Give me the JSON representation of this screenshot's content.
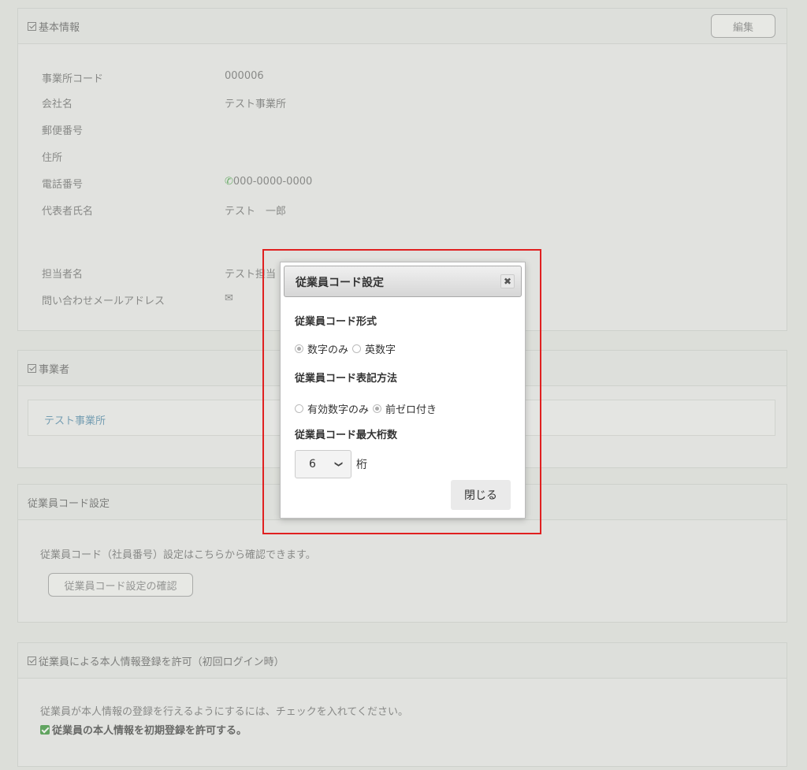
{
  "basic_info": {
    "title": "基本情報",
    "edit_label": "編集",
    "rows": [
      {
        "label": "事業所コード",
        "value": "000006"
      },
      {
        "label": "会社名",
        "value": "テスト事業所"
      },
      {
        "label": "郵便番号",
        "value": ""
      },
      {
        "label": "住所",
        "value": ""
      },
      {
        "label": "電話番号",
        "value": "000-0000-0000"
      },
      {
        "label": "代表者氏名",
        "value": "テスト　一郎"
      },
      {
        "label": "担当者名",
        "value": "テスト担当"
      },
      {
        "label": "問い合わせメールアドレス",
        "value": ""
      }
    ]
  },
  "business": {
    "title": "事業者",
    "link": "テスト事業所"
  },
  "employee_code": {
    "title": "従業員コード設定",
    "desc": "従業員コード（社員番号）設定はこちらから確認できます。",
    "button": "従業員コード設定の確認"
  },
  "self_register": {
    "title": "従業員による本人情報登録を許可（初回ログイン時）",
    "desc": "従業員が本人情報の登録を行えるようにするには、チェックを入れてください。",
    "checkbox_label": "従業員の本人情報を初期登録を許可する。"
  },
  "modal": {
    "title": "従業員コード設定",
    "format_label": "従業員コード形式",
    "format_options": [
      "数字のみ",
      "英数字"
    ],
    "format_selected": "数字のみ",
    "notation_label": "従業員コード表記方法",
    "notation_options": [
      "有効数字のみ",
      "前ゼロ付き"
    ],
    "notation_selected": "前ゼロ付き",
    "digits_label": "従業員コード最大桁数",
    "digits_value": "6",
    "digits_unit": "桁",
    "close_label": "閉じる"
  }
}
